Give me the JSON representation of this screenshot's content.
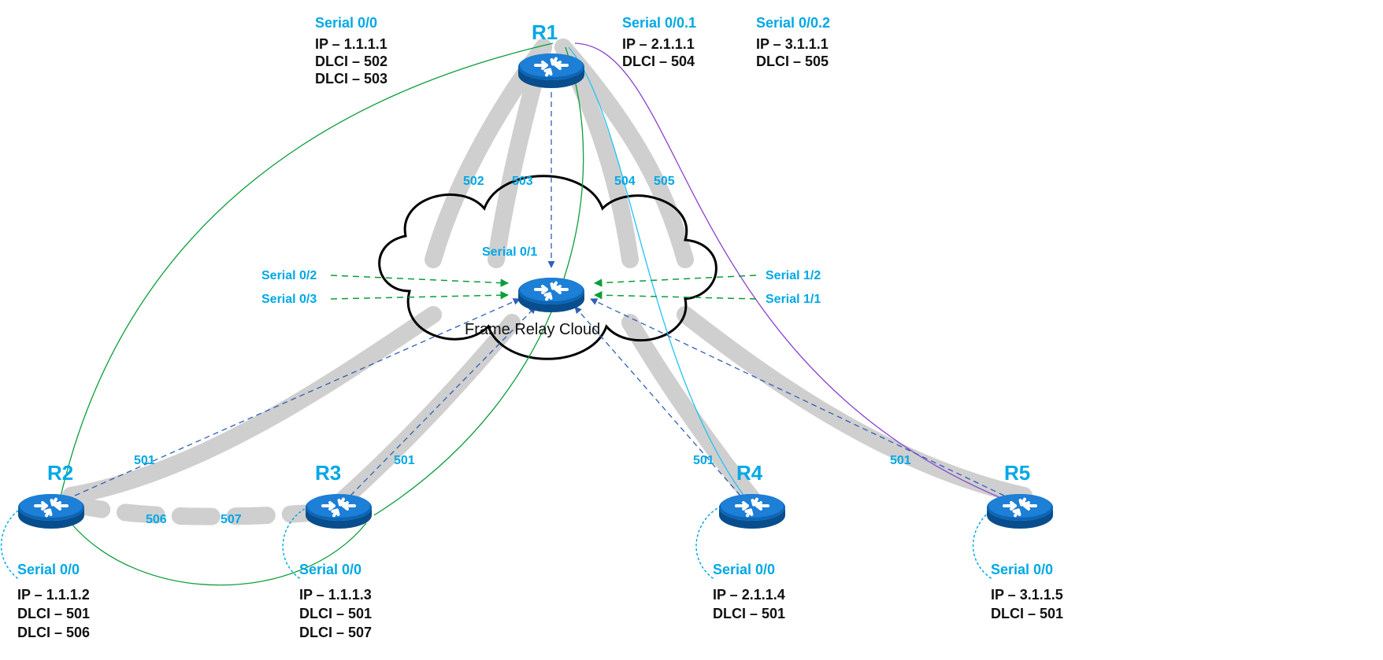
{
  "cloud_label": "Frame Relay Cloud",
  "r1": {
    "name": "R1",
    "if0": {
      "title": "Serial 0/0",
      "ip": "IP – 1.1.1.1",
      "d1": "DLCI – 502",
      "d2": "DLCI – 503"
    },
    "if01": {
      "title": "Serial 0/0.1",
      "ip": "IP – 2.1.1.1",
      "d1": "DLCI – 504"
    },
    "if02": {
      "title": "Serial 0/0.2",
      "ip": "IP – 3.1.1.1",
      "d1": "DLCI – 505"
    }
  },
  "r2": {
    "name": "R2",
    "if": {
      "title": "Serial 0/0",
      "ip": "IP – 1.1.1.2",
      "d1": "DLCI – 501",
      "d2": "DLCI – 506"
    }
  },
  "r3": {
    "name": "R3",
    "if": {
      "title": "Serial 0/0",
      "ip": "IP – 1.1.1.3",
      "d1": "DLCI – 501",
      "d2": "DLCI – 507"
    }
  },
  "r4": {
    "name": "R4",
    "if": {
      "title": "Serial 0/0",
      "ip": "IP – 2.1.1.4",
      "d1": "DLCI – 501"
    }
  },
  "r5": {
    "name": "R5",
    "if": {
      "title": "Serial 0/0",
      "ip": "IP – 3.1.1.5",
      "d1": "DLCI – 501"
    }
  },
  "cloud_ports": {
    "s01": "Serial 0/1",
    "s02": "Serial 0/2",
    "s03": "Serial 0/3",
    "s11": "Serial 1/1",
    "s12": "Serial 1/2"
  },
  "dlci": {
    "r1_502": "502",
    "r1_503": "503",
    "r1_504": "504",
    "r1_505": "505",
    "r2_501": "501",
    "r2_506": "506",
    "r3_507": "507",
    "r3_501": "501",
    "r4_501": "501",
    "r5_501": "501"
  }
}
